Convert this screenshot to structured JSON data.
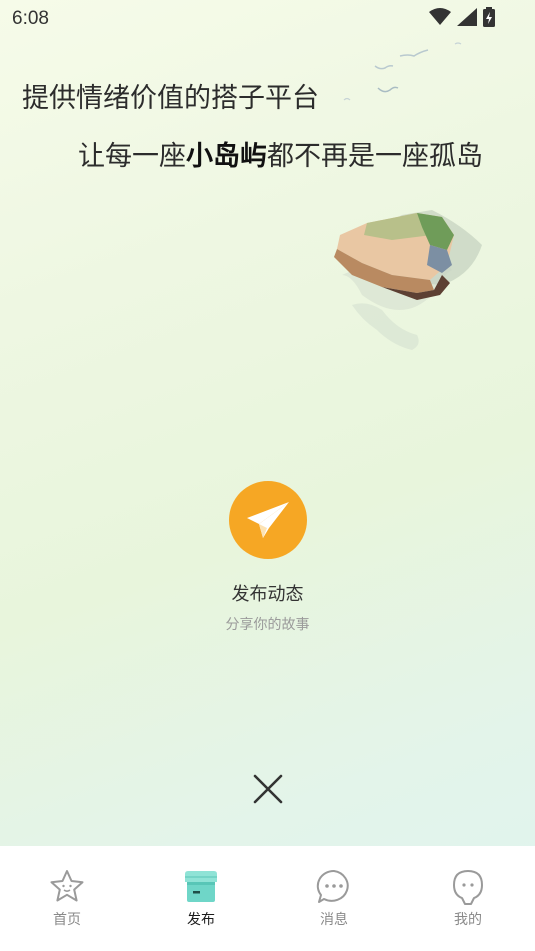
{
  "status_bar": {
    "time": "6:08",
    "icons": [
      "wifi-icon",
      "signal-icon",
      "battery-charging-icon"
    ]
  },
  "slogan": {
    "line1": "提供情绪价值的搭子平台",
    "line2_prefix": "让每一座",
    "line2_emphasis": "小岛屿",
    "line2_suffix": "都不再是一座孤岛"
  },
  "publish": {
    "icon": "paper-plane-icon",
    "title": "发布动态",
    "subtitle": "分享你的故事",
    "accent": "#f6a724"
  },
  "close": {
    "icon": "close-icon"
  },
  "tabbar": {
    "active": "发布",
    "tabs": [
      {
        "label": "首页",
        "icon": "star-face-icon"
      },
      {
        "label": "发布",
        "icon": "shop-icon"
      },
      {
        "label": "消息",
        "icon": "chat-bubble-icon"
      },
      {
        "label": "我的",
        "icon": "face-icon"
      }
    ]
  }
}
